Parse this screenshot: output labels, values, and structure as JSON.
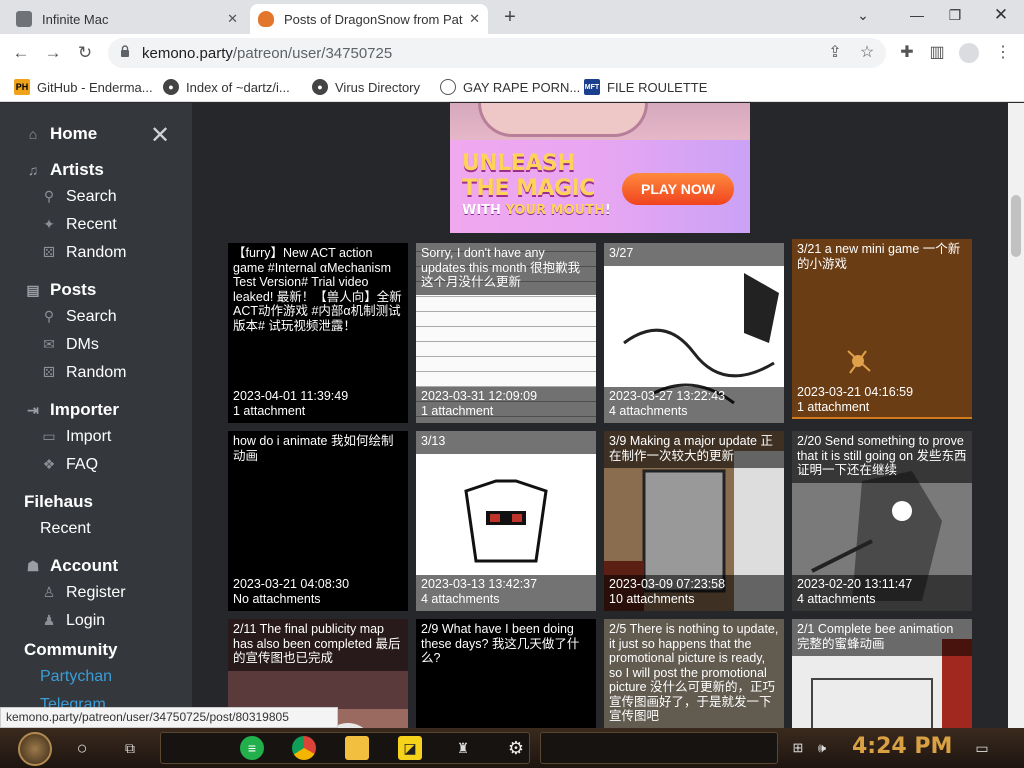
{
  "browser": {
    "tabs": [
      {
        "title": "Infinite Mac",
        "active": false
      },
      {
        "title": "Posts of DragonSnow from Patreon",
        "active": true
      }
    ],
    "new_tab": "+",
    "url_host": "kemono.party",
    "url_path": "/patreon/user/34750725",
    "bookmarks": [
      {
        "label": "GitHub - Enderma...",
        "icon": "PH"
      },
      {
        "label": "Index of ~dartz/i...",
        "icon": "globe-icon"
      },
      {
        "label": "Virus Directory",
        "icon": "globe-icon"
      },
      {
        "label": "GAY RAPE PORN...",
        "icon": "globe-icon"
      },
      {
        "label": "FILE ROULETTE",
        "icon": "MFT"
      }
    ],
    "status_url": "kemono.party/patreon/user/34750725/post/80319805"
  },
  "sidebar": {
    "home": "Home",
    "artists": {
      "title": "Artists",
      "items": [
        "Search",
        "Recent",
        "Random"
      ]
    },
    "posts": {
      "title": "Posts",
      "items": [
        "Search",
        "DMs",
        "Random"
      ]
    },
    "importer": {
      "title": "Importer",
      "items": [
        "Import",
        "FAQ"
      ]
    },
    "filehaus": {
      "title": "Filehaus",
      "items": [
        "Recent"
      ]
    },
    "account": {
      "title": "Account",
      "items": [
        "Register",
        "Login"
      ]
    },
    "community": {
      "title": "Community",
      "items": [
        "Partychan",
        "Telegram"
      ]
    }
  },
  "ad": {
    "line1": "UNLEASH",
    "line2": "THE MAGIC",
    "line3_a": "WITH ",
    "line3_b": "YOUR MOUTH",
    "line3_c": "!",
    "cta": "PLAY NOW"
  },
  "posts": [
    {
      "title": "【furry】New ACT action game #Internal αMechanism Test Version# Trial video leaked! 最新！【兽人向】全新ACT动作游戏 #内部α机制测试版本# 试玩视频泄露！",
      "date": "2023-04-01 11:39:49",
      "attachments": "1 attachment"
    },
    {
      "title": "Sorry, I don't have any updates this month 很抱歉我这个月没什么更新",
      "date": "2023-03-31 12:09:09",
      "attachments": "1 attachment"
    },
    {
      "title": "3/27",
      "date": "2023-03-27 13:22:43",
      "attachments": "4 attachments"
    },
    {
      "title": "3/21 a new mini game 一个新的小游戏",
      "date": "2023-03-21 04:16:59",
      "attachments": "1 attachment"
    },
    {
      "title": "how do i animate 我如何绘制动画",
      "date": "2023-03-21 04:08:30",
      "attachments": "No attachments"
    },
    {
      "title": "3/13",
      "date": "2023-03-13 13:42:37",
      "attachments": "4 attachments"
    },
    {
      "title": "3/9 Making a major update 正在制作一次较大的更新",
      "date": "2023-03-09 07:23:58",
      "attachments": "10 attachments"
    },
    {
      "title": "2/20 Send something to prove that it is still going on 发些东西证明一下还在继续",
      "date": "2023-02-20 13:11:47",
      "attachments": "4 attachments"
    },
    {
      "title": "2/11 The final publicity map has also been completed 最后的宣传图也已完成",
      "date": "",
      "attachments": ""
    },
    {
      "title": "2/9 What have I been doing these days? 我这几天做了什么?",
      "date": "",
      "attachments": ""
    },
    {
      "title": "2/5 There is nothing to update, it just so happens that the promotional picture is ready, so I will post the promotional picture 没什么可更新的，正巧宣传图画好了，于是就发一下宣传图吧",
      "date": "",
      "attachments": ""
    },
    {
      "title": "2/1 Complete bee animation 完整的蜜蜂动画",
      "date": "",
      "attachments": ""
    }
  ],
  "taskbar": {
    "clock": "4:24 PM"
  }
}
